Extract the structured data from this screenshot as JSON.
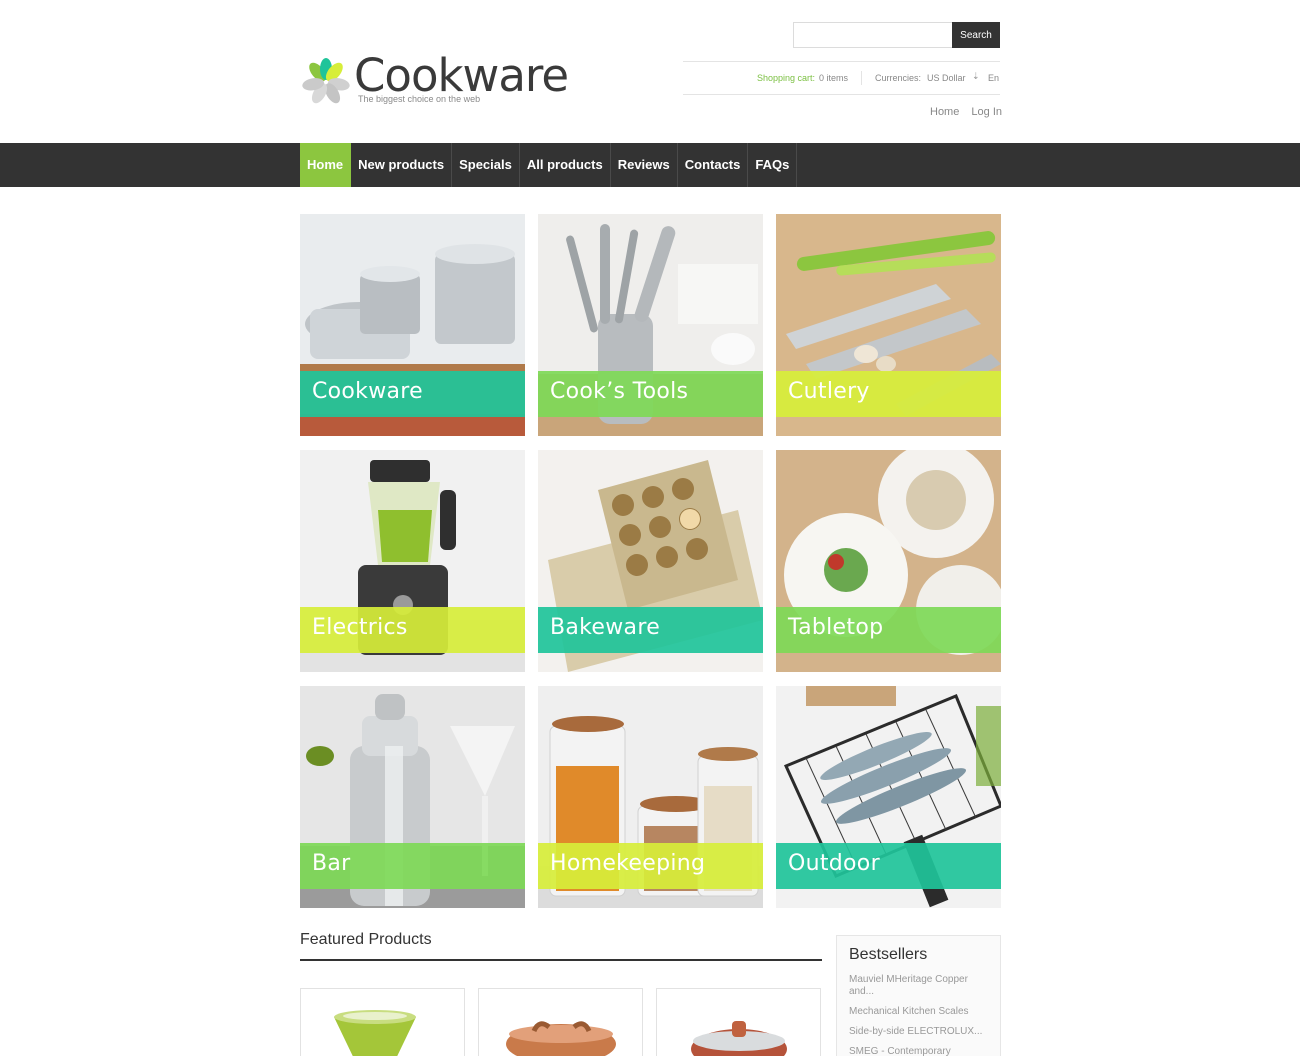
{
  "brand": {
    "name": "Cookware",
    "tagline": "The biggest choice on the web",
    "colors": {
      "leaf_green": "#8cc63f",
      "teal": "#1fc49a",
      "lime": "#d7ee3a",
      "grey": "#cccccc"
    }
  },
  "search": {
    "placeholder": "",
    "button_label": "Search"
  },
  "infobar": {
    "cart_label": "Shopping cart:",
    "cart_count": "0 items",
    "currency_label": "Currencies:",
    "currency_value": "US Dollar",
    "language": "En"
  },
  "toplinks": {
    "home": "Home",
    "login": "Log In"
  },
  "nav": {
    "items": [
      {
        "label": "Home",
        "active": true
      },
      {
        "label": "New products"
      },
      {
        "label": "Specials"
      },
      {
        "label": "All products"
      },
      {
        "label": "Reviews"
      },
      {
        "label": "Contacts"
      },
      {
        "label": "FAQs"
      }
    ],
    "colors": {
      "bar": "#333333",
      "active": "#8cc63f"
    }
  },
  "categories": [
    {
      "label": "Cookware",
      "band_color": "#1fc49a"
    },
    {
      "label": "Cook’s Tools",
      "band_color": "#7ed957"
    },
    {
      "label": "Cutlery",
      "band_color": "#d7ee3a"
    },
    {
      "label": "Electrics",
      "band_color": "#d7ee3a"
    },
    {
      "label": "Bakeware",
      "band_color": "#1fc49a"
    },
    {
      "label": "Tabletop",
      "band_color": "#7ed957"
    },
    {
      "label": "Bar",
      "band_color": "#7ed957"
    },
    {
      "label": "Homekeeping",
      "band_color": "#d7ee3a"
    },
    {
      "label": "Outdoor",
      "band_color": "#1fc49a"
    }
  ],
  "featured": {
    "title": "Featured Products"
  },
  "bestsellers": {
    "title": "Bestsellers",
    "items": [
      "Mauviel MHeritage Copper and...",
      "Mechanical Kitchen Scales",
      "Side-by-side ELECTROLUX...",
      "SMEG - Contemporary"
    ]
  }
}
